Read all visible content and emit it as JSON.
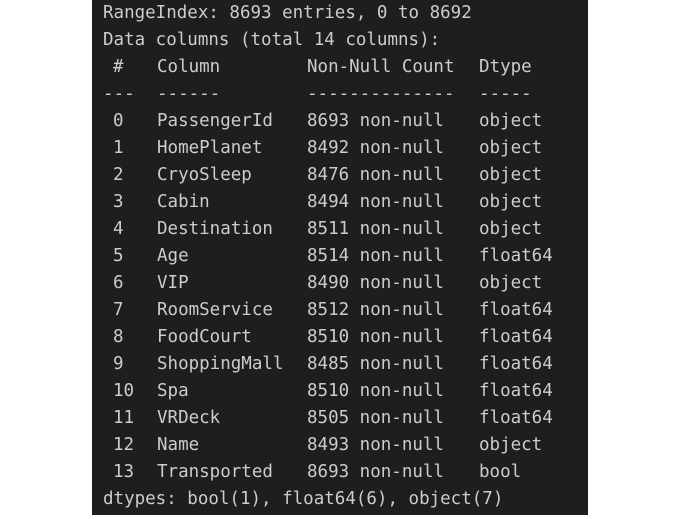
{
  "summary": {
    "range_index": "RangeIndex: 8693 entries, 0 to 8692",
    "columns_info": "Data columns (total 14 columns):"
  },
  "table": {
    "headers": {
      "num": "#",
      "column": "Column",
      "count": "Non-Null Count",
      "dtype": "Dtype"
    },
    "separators": {
      "num": "---",
      "column": "------",
      "count": "--------------",
      "dtype": "-----"
    },
    "rows": [
      {
        "num": "0",
        "column": "PassengerId",
        "count": "8693 non-null",
        "dtype": "object"
      },
      {
        "num": "1",
        "column": "HomePlanet",
        "count": "8492 non-null",
        "dtype": "object"
      },
      {
        "num": "2",
        "column": "CryoSleep",
        "count": "8476 non-null",
        "dtype": "object"
      },
      {
        "num": "3",
        "column": "Cabin",
        "count": "8494 non-null",
        "dtype": "object"
      },
      {
        "num": "4",
        "column": "Destination",
        "count": "8511 non-null",
        "dtype": "object"
      },
      {
        "num": "5",
        "column": "Age",
        "count": "8514 non-null",
        "dtype": "float64"
      },
      {
        "num": "6",
        "column": "VIP",
        "count": "8490 non-null",
        "dtype": "object"
      },
      {
        "num": "7",
        "column": "RoomService",
        "count": "8512 non-null",
        "dtype": "float64"
      },
      {
        "num": "8",
        "column": "FoodCourt",
        "count": "8510 non-null",
        "dtype": "float64"
      },
      {
        "num": "9",
        "column": "ShoppingMall",
        "count": "8485 non-null",
        "dtype": "float64"
      },
      {
        "num": "10",
        "column": "Spa",
        "count": "8510 non-null",
        "dtype": "float64"
      },
      {
        "num": "11",
        "column": "VRDeck",
        "count": "8505 non-null",
        "dtype": "float64"
      },
      {
        "num": "12",
        "column": "Name",
        "count": "8493 non-null",
        "dtype": "object"
      },
      {
        "num": "13",
        "column": "Transported",
        "count": "8693 non-null",
        "dtype": "bool"
      }
    ]
  },
  "footer": {
    "dtypes": "dtypes: bool(1), float64(6), object(7)"
  },
  "colors": {
    "background": "#1e1e1e",
    "text": "#cccccc"
  }
}
